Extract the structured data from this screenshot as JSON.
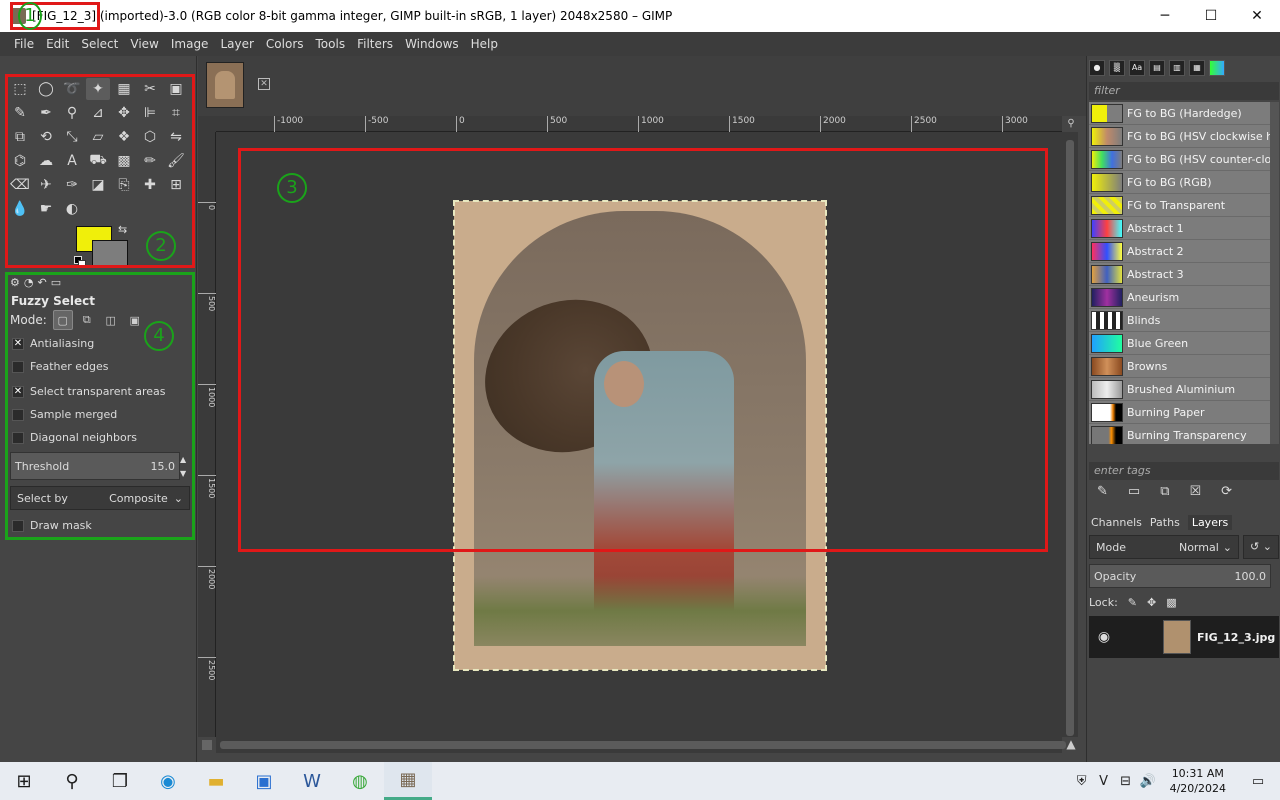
{
  "window": {
    "title": "[FIG_12_3] (imported)-3.0 (RGB color 8-bit gamma integer, GIMP built-in sRGB, 1 layer) 2048x2580 – GIMP",
    "minimize": "─",
    "maximize": "☐",
    "close": "✕"
  },
  "menu": [
    "File",
    "Edit",
    "Select",
    "View",
    "Image",
    "Layer",
    "Colors",
    "Tools",
    "Filters",
    "Windows",
    "Help"
  ],
  "tools": [
    {
      "icon": "rect-select-icon",
      "glyph": "⬚"
    },
    {
      "icon": "ellipse-select-icon",
      "glyph": "◯"
    },
    {
      "icon": "free-select-icon",
      "glyph": "➰"
    },
    {
      "icon": "fuzzy-select-icon",
      "glyph": "✦"
    },
    {
      "icon": "select-by-color-icon",
      "glyph": "▦"
    },
    {
      "icon": "scissors-select-icon",
      "glyph": "✂"
    },
    {
      "icon": "foreground-select-icon",
      "glyph": "▣"
    },
    {
      "icon": "paths-icon",
      "glyph": "✎"
    },
    {
      "icon": "color-picker-icon",
      "glyph": "✒"
    },
    {
      "icon": "zoom-icon",
      "glyph": "⚲"
    },
    {
      "icon": "measure-icon",
      "glyph": "⊿"
    },
    {
      "icon": "move-icon",
      "glyph": "✥"
    },
    {
      "icon": "align-icon",
      "glyph": "⊫"
    },
    {
      "icon": "crop-icon",
      "glyph": "⌗"
    },
    {
      "icon": "unified-transform-icon",
      "glyph": "⧉"
    },
    {
      "icon": "rotate-icon",
      "glyph": "⟲"
    },
    {
      "icon": "scale-icon",
      "glyph": "⤡"
    },
    {
      "icon": "shear-icon",
      "glyph": "▱"
    },
    {
      "icon": "warp-icon",
      "glyph": "❖"
    },
    {
      "icon": "perspective-icon",
      "glyph": "⬡"
    },
    {
      "icon": "flip-icon",
      "glyph": "⇋"
    },
    {
      "icon": "cage-icon",
      "glyph": "⌬"
    },
    {
      "icon": "smudge-icon",
      "glyph": "☁"
    },
    {
      "icon": "text-icon",
      "glyph": "A"
    },
    {
      "icon": "bucket-fill-icon",
      "glyph": "⛟"
    },
    {
      "icon": "pattern-icon",
      "glyph": "▩"
    },
    {
      "icon": "pencil-icon",
      "glyph": "✏"
    },
    {
      "icon": "paintbrush-icon",
      "glyph": "🖌"
    },
    {
      "icon": "eraser-icon",
      "glyph": "⌫"
    },
    {
      "icon": "airbrush-icon",
      "glyph": "✈"
    },
    {
      "icon": "ink-icon",
      "glyph": "✑"
    },
    {
      "icon": "mypaint-brush-icon",
      "glyph": "◪"
    },
    {
      "icon": "clone-icon",
      "glyph": "⎘"
    },
    {
      "icon": "heal-icon",
      "glyph": "✚"
    },
    {
      "icon": "perspective-clone-icon",
      "glyph": "⊞"
    },
    {
      "icon": "blur-icon",
      "glyph": "💧"
    },
    {
      "icon": "smudge-tool-icon",
      "glyph": "☛"
    },
    {
      "icon": "dodge-burn-icon",
      "glyph": "◐"
    }
  ],
  "tool_options": {
    "title": "Fuzzy Select",
    "mode_label": "Mode:",
    "antialiasing": "Antialiasing",
    "feather_edges": "Feather edges",
    "select_transparent": "Select transparent areas",
    "sample_merged": "Sample merged",
    "diagonal_neighbors": "Diagonal neighbors",
    "threshold_label": "Threshold",
    "threshold_value": "15.0",
    "select_by_label": "Select by",
    "select_by_value": "Composite",
    "draw_mask": "Draw mask",
    "checked_mark": "✕"
  },
  "rulers": {
    "h_ticks": [
      "-1000",
      "-500",
      "0",
      "500",
      "1000",
      "1500",
      "2000",
      "2500",
      "3000"
    ],
    "v_ticks": [
      "0",
      "500",
      "1000",
      "1500",
      "2000",
      "2500"
    ]
  },
  "gradients": {
    "filter_placeholder": "filter",
    "tags_placeholder": "enter tags",
    "items": [
      {
        "name": "FG to BG (Hardedge)",
        "swatch": "linear-gradient(90deg,#f0ef0a 50%,#7d7d7d 50%)"
      },
      {
        "name": "FG to BG (HSV clockwise hue)",
        "swatch": "linear-gradient(90deg,#f0ef0a,#c08a6a,#7d7d7d)"
      },
      {
        "name": "FG to BG (HSV counter-clockwise)",
        "swatch": "linear-gradient(90deg,#f0ef0a,#40e060,#4070e0,#7d7d7d)"
      },
      {
        "name": "FG to BG (RGB)",
        "swatch": "linear-gradient(90deg,#f0ef0a,#7d7d7d)"
      },
      {
        "name": "FG to Transparent",
        "swatch": "repeating-linear-gradient(45deg,#f0ef0a 0 4px,#cfcf60 4px 8px)"
      },
      {
        "name": "Abstract 1",
        "swatch": "linear-gradient(90deg,#4040ff,#ff4040,#40ffff)"
      },
      {
        "name": "Abstract 2",
        "swatch": "linear-gradient(90deg,#ff3060,#3050ff,#ffff40)"
      },
      {
        "name": "Abstract 3",
        "swatch": "linear-gradient(90deg,#e0a040,#4060c0,#e0e040)"
      },
      {
        "name": "Aneurism",
        "swatch": "linear-gradient(90deg,#202060,#a030a0,#202060)"
      },
      {
        "name": "Blinds",
        "swatch": "repeating-linear-gradient(90deg,#fff 0 4px,#222 4px 8px)"
      },
      {
        "name": "Blue Green",
        "swatch": "linear-gradient(90deg,#20a0ff,#20ffa0)"
      },
      {
        "name": "Browns",
        "swatch": "linear-gradient(90deg,#8a4a20,#d0905a,#8a4a20)"
      },
      {
        "name": "Brushed Aluminium",
        "swatch": "linear-gradient(90deg,#bbb,#eee,#999)"
      },
      {
        "name": "Burning Paper",
        "swatch": "linear-gradient(90deg,#fff 60%,#f08000 70%,#000 80%)"
      },
      {
        "name": "Burning Transparency",
        "swatch": "linear-gradient(90deg,#777 55%,#ff9000 65%,#000 80%)"
      }
    ]
  },
  "layers_panel": {
    "tabs": [
      "Channels",
      "Paths",
      "Layers"
    ],
    "mode_label": "Mode",
    "mode_value": "Normal",
    "opacity_label": "Opacity",
    "opacity_value": "100.0",
    "lock_label": "Lock:",
    "layer_name": "FIG_12_3.jpg"
  },
  "annotations": {
    "one": "1",
    "two": "2",
    "three": "3",
    "four": "4"
  },
  "taskbar": {
    "time": "10:31 AM",
    "date": "4/20/2024"
  }
}
